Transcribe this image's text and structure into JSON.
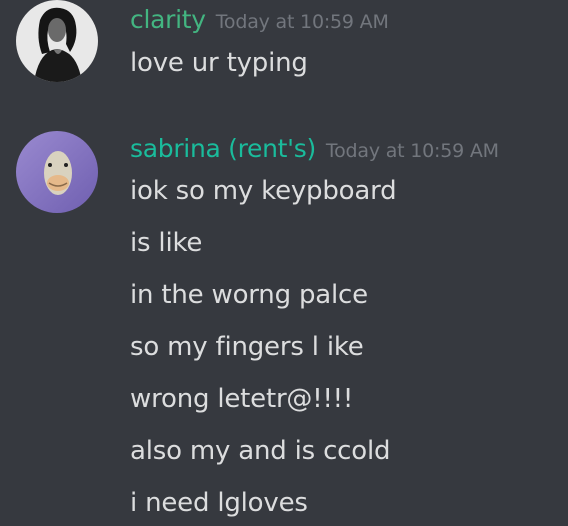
{
  "messages": [
    {
      "author": "clarity",
      "author_color": "#43b581",
      "timestamp": "Today at 10:59 AM",
      "lines": [
        "love ur typing"
      ]
    },
    {
      "author": "sabrina (rent's)",
      "author_color": "#1abc9c",
      "timestamp": "Today at 10:59 AM",
      "lines": [
        "iok so my keypboard",
        "is like",
        "in the worng palce",
        "so my fingers l ike",
        "wrong letetr@!!!!",
        "also my and is ccold",
        "i need lgloves"
      ]
    }
  ],
  "colors": {
    "background": "#36393f",
    "message_text": "#dcddde",
    "timestamp": "#72767d"
  }
}
